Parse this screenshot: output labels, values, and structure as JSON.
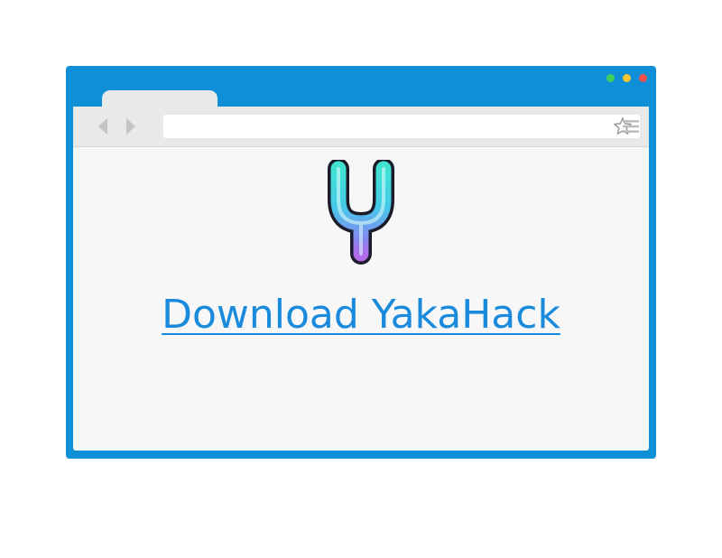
{
  "window": {
    "controls": [
      "green-dot",
      "yellow-dot",
      "red-dot"
    ],
    "accent_color": "#0e8fd8"
  },
  "toolbar": {
    "back_icon": "chevron-left-icon",
    "forward_icon": "chevron-right-icon",
    "address_value": "",
    "bookmark_icon": "star-icon",
    "menu_icon": "hamburger-menu-icon"
  },
  "main": {
    "logo_icon": "yakahack-logo-icon",
    "download_link": "Download YakaHack",
    "link_color": "#1a8bdc"
  }
}
